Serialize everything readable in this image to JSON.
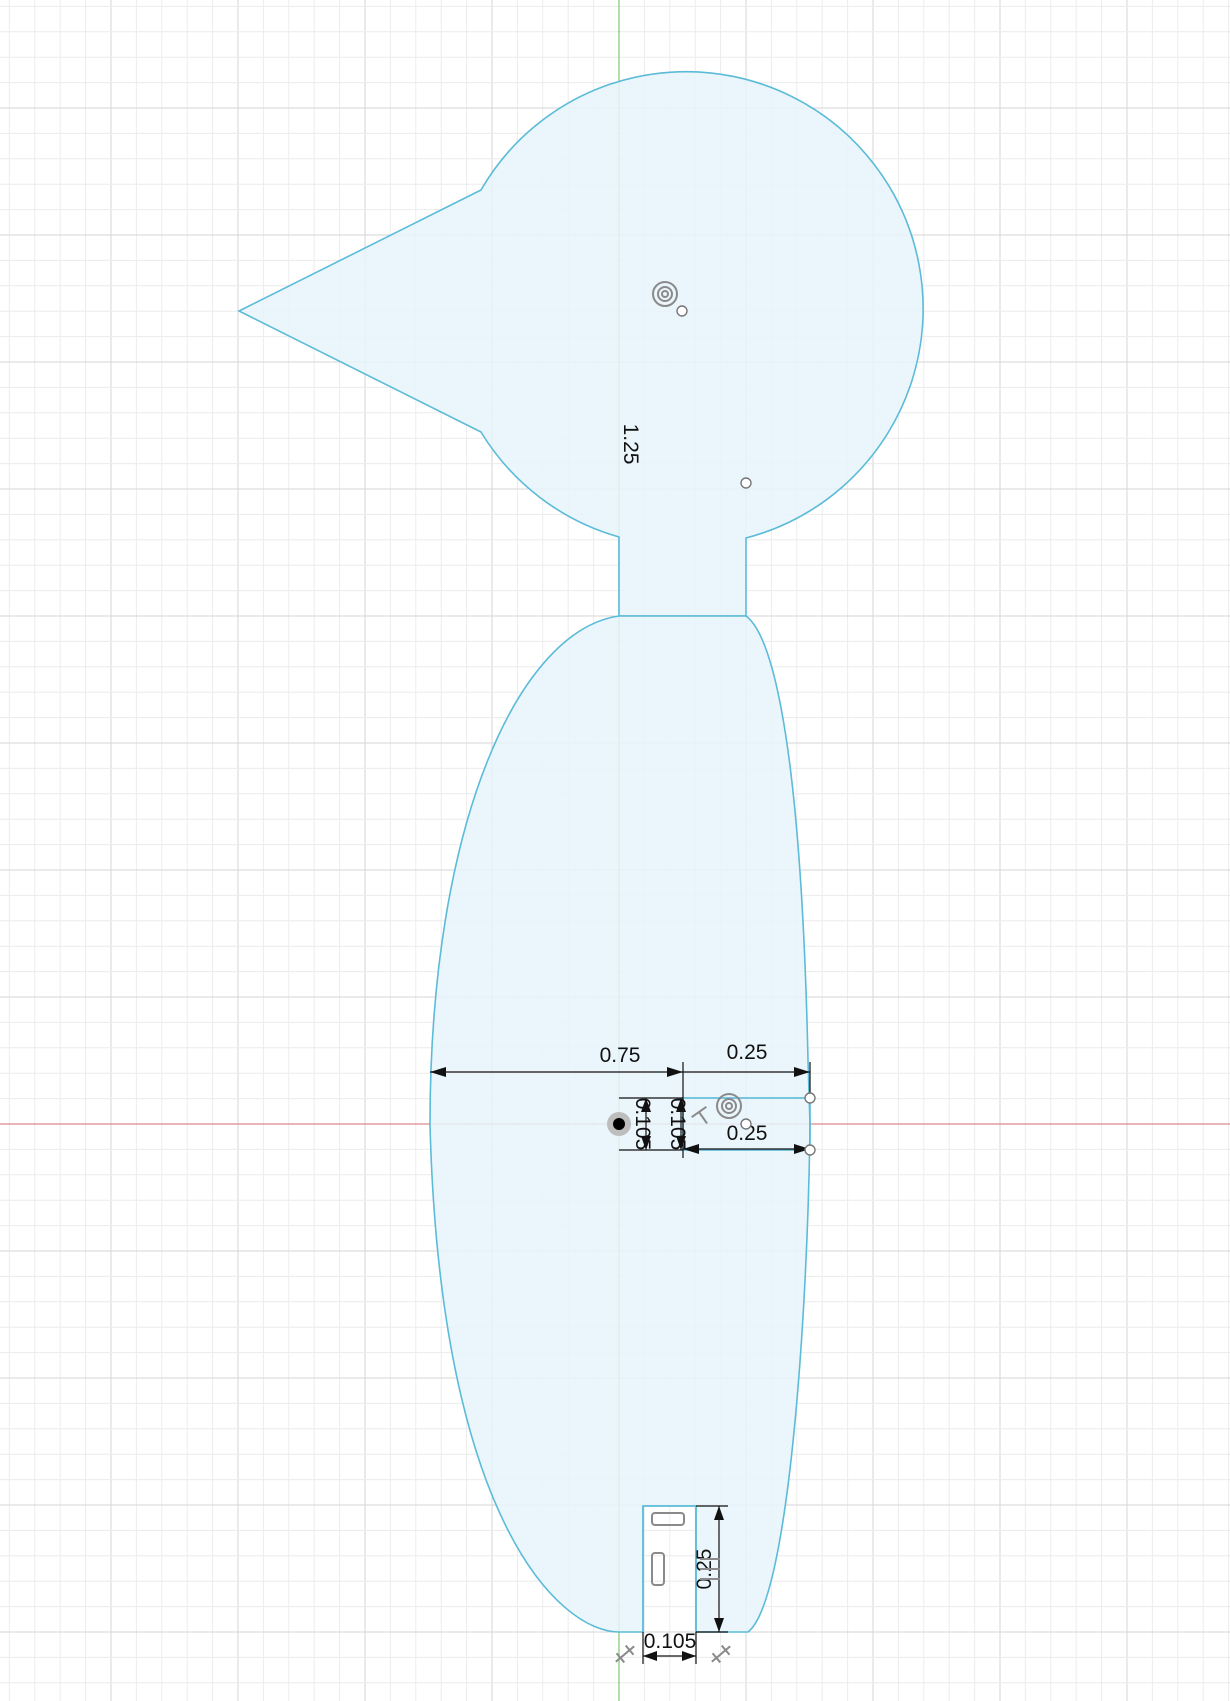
{
  "colors": {
    "background": "#ffffff",
    "grid_minor": "#ececec",
    "grid_major": "#d6d6d6",
    "axis_vertical": "#7ccb6e",
    "axis_horizontal": "#d98b8b",
    "profile_stroke": "#5bbbd8",
    "profile_fill": "#e6f4fb",
    "dimension": "#111111",
    "constraint_icon": "#8a8a8a"
  },
  "dimensions": {
    "neck_height": "1.25",
    "body_half_width": "0.75",
    "slot_width_top": "0.25",
    "slot_width_bottom": "0.25",
    "slot_height_left": "0.105",
    "slot_height_right": "0.105",
    "foot_height": "0.25",
    "foot_width": "0.105"
  },
  "icons": {
    "center_point_head": "concentric-circle-icon",
    "center_point_slot": "concentric-circle-icon",
    "origin": "origin-point-icon",
    "foot_constraints": [
      "horizontal-constraint-icon",
      "vertical-constraint-icon",
      "parallel-constraint-icon",
      "fix-constraint-icon"
    ]
  }
}
